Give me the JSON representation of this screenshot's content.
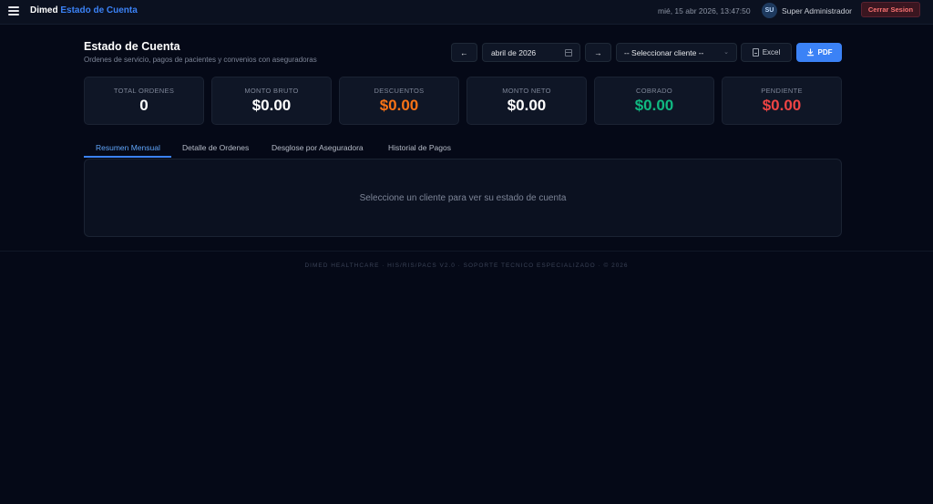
{
  "topbar": {
    "brand_primary": "Dimed",
    "brand_secondary": "Estado de Cuenta",
    "datetime": "mié, 15 abr 2026, 13:47:50",
    "avatar_initials": "SU",
    "username": "Super Administrador",
    "logout_label": "Cerrar Sesion",
    "menu_icon": "hamburger-menu-icon"
  },
  "header": {
    "title": "Estado de Cuenta",
    "subtitle": "Ordenes de servicio, pagos de pacientes y convenios con aseguradoras"
  },
  "controls": {
    "prev_label": "←",
    "month_value": "abril de 2026",
    "next_label": "→",
    "client_select": "-- Seleccionar cliente --",
    "excel_label": "Excel",
    "pdf_label": "PDF"
  },
  "stats": [
    {
      "label": "TOTAL ORDENES",
      "value": "0",
      "color": "#ffffff"
    },
    {
      "label": "MONTO BRUTO",
      "value": "$0.00",
      "color": "#ffffff"
    },
    {
      "label": "DESCUENTOS",
      "value": "$0.00",
      "color": "#f97316"
    },
    {
      "label": "MONTO NETO",
      "value": "$0.00",
      "color": "#ffffff"
    },
    {
      "label": "COBRADO",
      "value": "$0.00",
      "color": "#10b981"
    },
    {
      "label": "PENDIENTE",
      "value": "$0.00",
      "color": "#ef4444"
    }
  ],
  "tabs": [
    {
      "label": "Resumen Mensual",
      "active": true
    },
    {
      "label": "Detalle de Ordenes",
      "active": false
    },
    {
      "label": "Desglose por Aseguradora",
      "active": false
    },
    {
      "label": "Historial de Pagos",
      "active": false
    }
  ],
  "panel": {
    "empty_message": "Seleccione un cliente para ver su estado de cuenta"
  },
  "footer": {
    "text": "DIMED HEALTHCARE · HIS/RIS/PACS V2.0 · SOPORTE TECNICO ESPECIALIZADO · © 2026"
  },
  "colors": {
    "accent": "#3b82f6",
    "background": "#050917",
    "discount": "#f97316",
    "collected": "#10b981",
    "pending": "#ef4444"
  }
}
